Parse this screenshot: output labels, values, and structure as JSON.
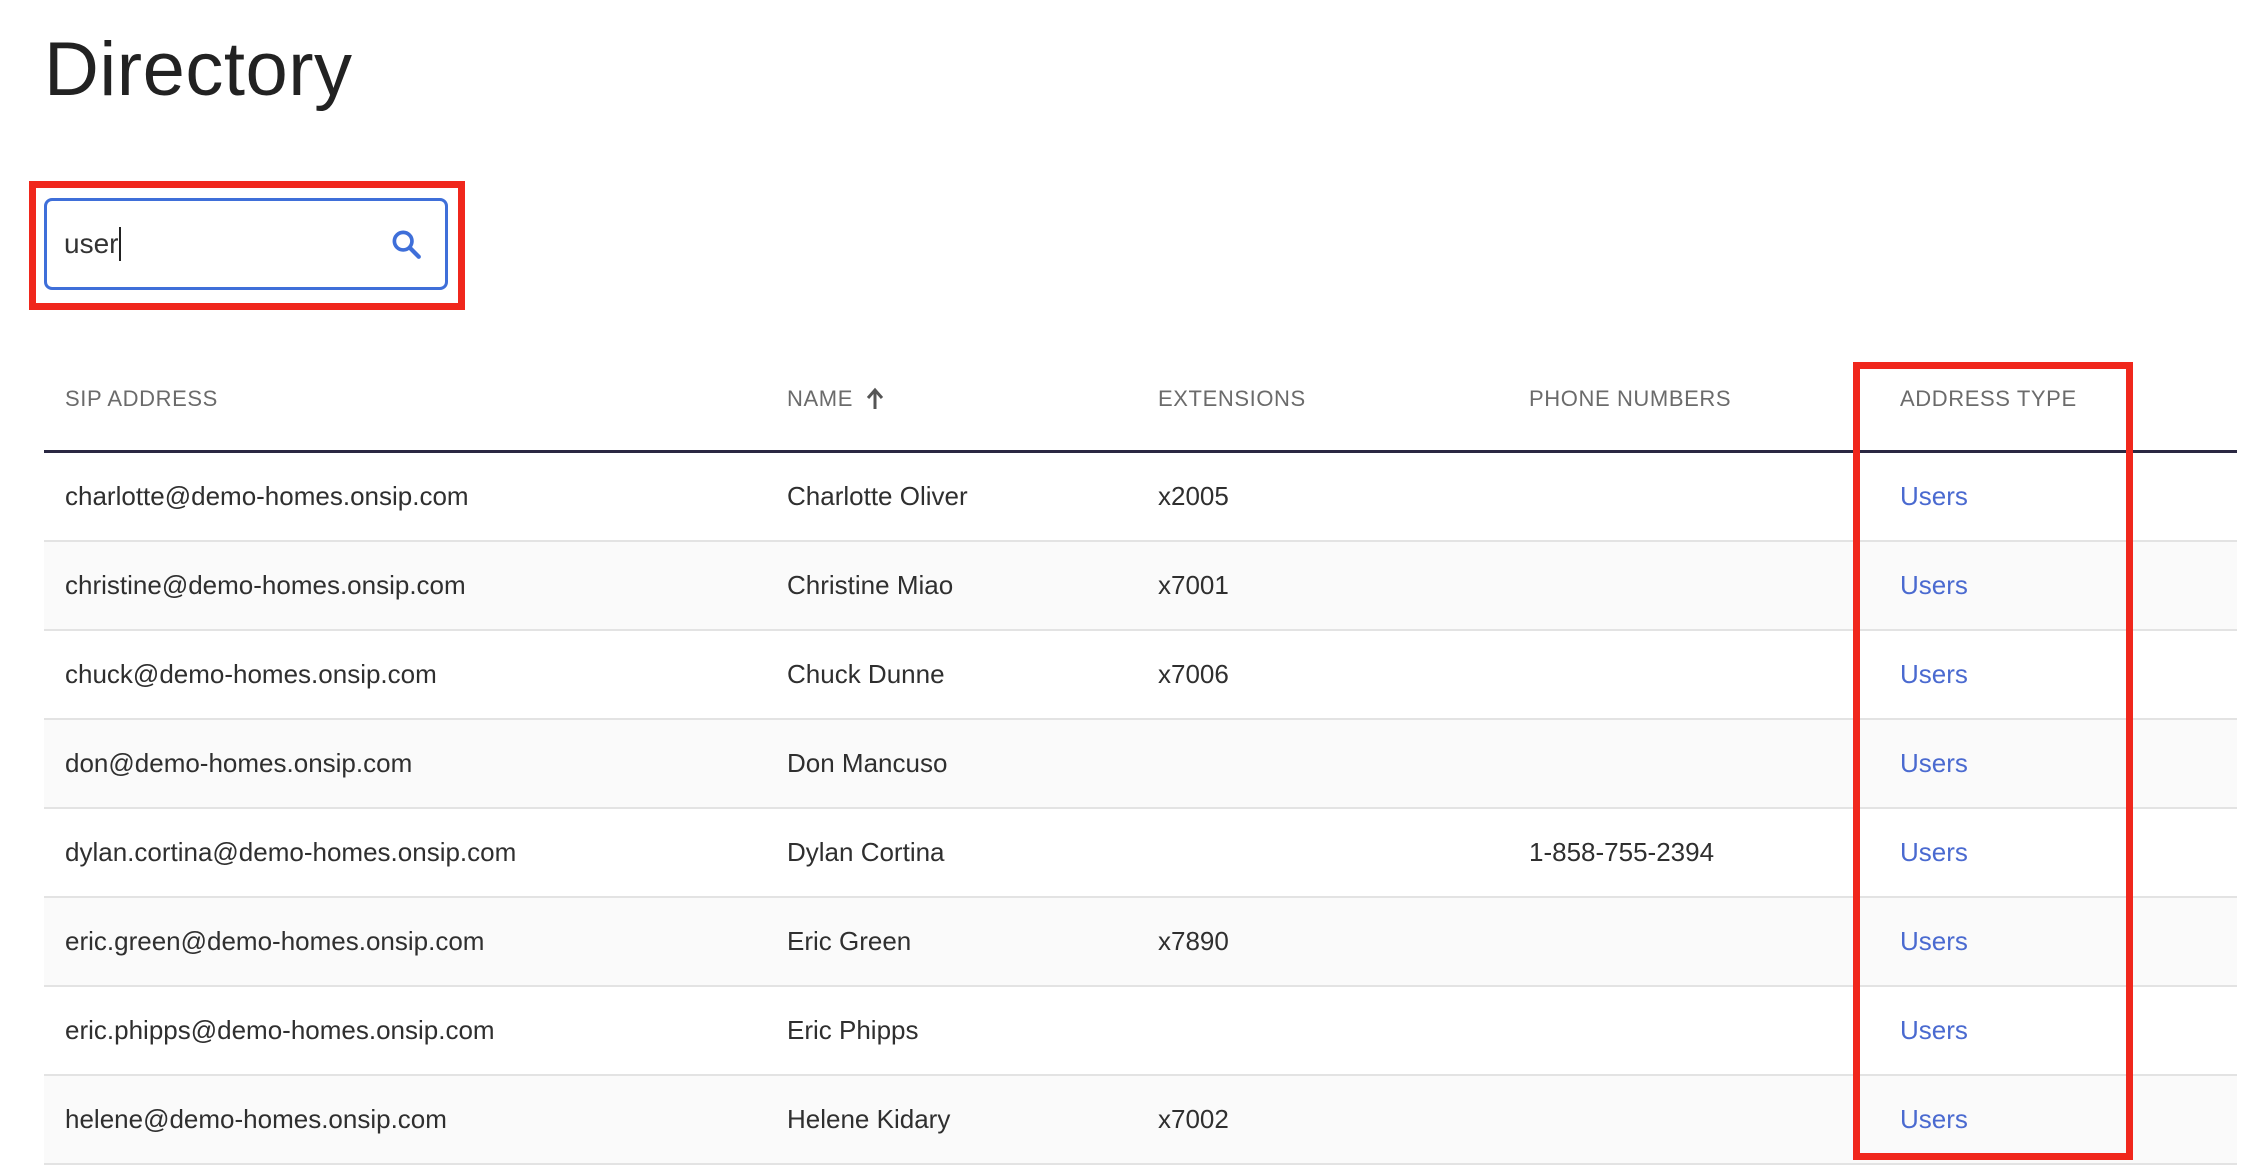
{
  "page": {
    "title": "Directory"
  },
  "search": {
    "value": "user"
  },
  "table": {
    "columns": {
      "sip": "SIP ADDRESS",
      "name": "NAME",
      "extensions": "EXTENSIONS",
      "phone": "PHONE NUMBERS",
      "type": "ADDRESS TYPE"
    },
    "sort": {
      "column": "name",
      "direction": "ascending"
    },
    "rows": [
      {
        "sip": "charlotte@demo-homes.onsip.com",
        "name": "Charlotte Oliver",
        "ext": "x2005",
        "phone": "",
        "type": "Users"
      },
      {
        "sip": "christine@demo-homes.onsip.com",
        "name": "Christine Miao",
        "ext": "x7001",
        "phone": "",
        "type": "Users"
      },
      {
        "sip": "chuck@demo-homes.onsip.com",
        "name": "Chuck Dunne",
        "ext": "x7006",
        "phone": "",
        "type": "Users"
      },
      {
        "sip": "don@demo-homes.onsip.com",
        "name": "Don Mancuso",
        "ext": "",
        "phone": "",
        "type": "Users"
      },
      {
        "sip": "dylan.cortina@demo-homes.onsip.com",
        "name": "Dylan Cortina",
        "ext": "",
        "phone": "1-858-755-2394",
        "type": "Users"
      },
      {
        "sip": "eric.green@demo-homes.onsip.com",
        "name": "Eric Green",
        "ext": "x7890",
        "phone": "",
        "type": "Users"
      },
      {
        "sip": "eric.phipps@demo-homes.onsip.com",
        "name": "Eric Phipps",
        "ext": "",
        "phone": "",
        "type": "Users"
      },
      {
        "sip": "helene@demo-homes.onsip.com",
        "name": "Helene Kidary",
        "ext": "x7002",
        "phone": "",
        "type": "Users"
      }
    ]
  },
  "colors": {
    "accent": "#3f6fd9",
    "link": "#4a6ad0",
    "highlight": "#f0271c",
    "header_rule": "#2a2842"
  },
  "icons": {
    "search": "search-icon",
    "sort": "arrow-up-icon"
  }
}
